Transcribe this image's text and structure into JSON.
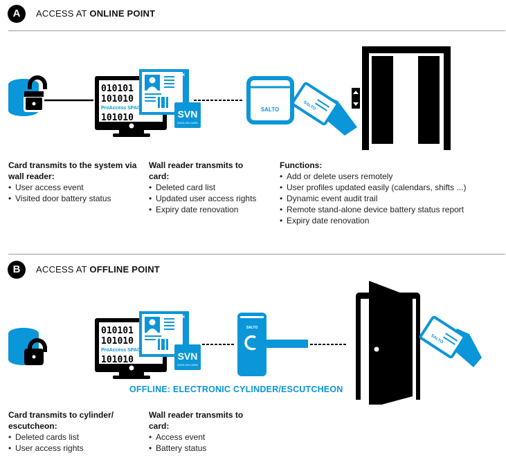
{
  "colors": {
    "accent": "#0a96d8",
    "ink": "#000000"
  },
  "section_a": {
    "badge": "A",
    "title_prefix": "ACCESS AT ",
    "title_bold": "ONLINE POINT",
    "icons": [
      "database-lock-icon",
      "computer-monitor-icon",
      "user-profile-card-icon",
      "svn-data-on-card-icon",
      "wall-reader-icon",
      "hand-card-icon",
      "elevator-door-icon"
    ],
    "monitor_text": {
      "row1": "010101",
      "row2": "101010",
      "brand": "ProAccess SPACE",
      "row3": "101010"
    },
    "svn_label": "SVN",
    "svn_sub": "DATA-ON-CARD",
    "reader_label": "SALTO",
    "card_label": "SALTO",
    "columns": [
      {
        "heading": "Card transmits to the system via wall reader:",
        "items": [
          "User access event",
          "Visited door battery status"
        ]
      },
      {
        "heading": "Wall reader transmits to card:",
        "items": [
          "Deleted card list",
          "Updated user access rights",
          "Expiry date renovation"
        ]
      },
      {
        "heading": "Functions:",
        "items": [
          "Add or delete users remotely",
          "User profiles updated easily (calendars, shifts ...)",
          "Dynamic event audit trail",
          "Remote stand-alone device battery status report",
          "Expiry date renovation"
        ]
      }
    ]
  },
  "section_b": {
    "badge": "B",
    "title_prefix": "ACCESS AT ",
    "title_bold": "OFFLINE POINT",
    "icons": [
      "database-lock-icon",
      "computer-monitor-icon",
      "user-profile-card-icon",
      "svn-data-on-card-icon",
      "escutcheon-icon",
      "open-door-icon",
      "hand-card-icon"
    ],
    "monitor_text": {
      "row1": "010101",
      "row2": "101010",
      "brand": "ProAccess SPACE",
      "row3": "101010"
    },
    "svn_label": "SVN",
    "svn_sub": "DATA-ON-CARD",
    "escutcheon_label": "SALTO",
    "card_label": "SALTO",
    "offline_caption": "OFFLINE: ELECTRONIC CYLINDER/ESCUTCHEON",
    "columns": [
      {
        "heading": "Card transmits to cylinder/ escutcheon:",
        "items": [
          "Deleted cards list",
          "User access rights"
        ]
      },
      {
        "heading": "Wall reader transmits to card:",
        "items": [
          "Access event",
          "Battery status"
        ]
      }
    ]
  }
}
